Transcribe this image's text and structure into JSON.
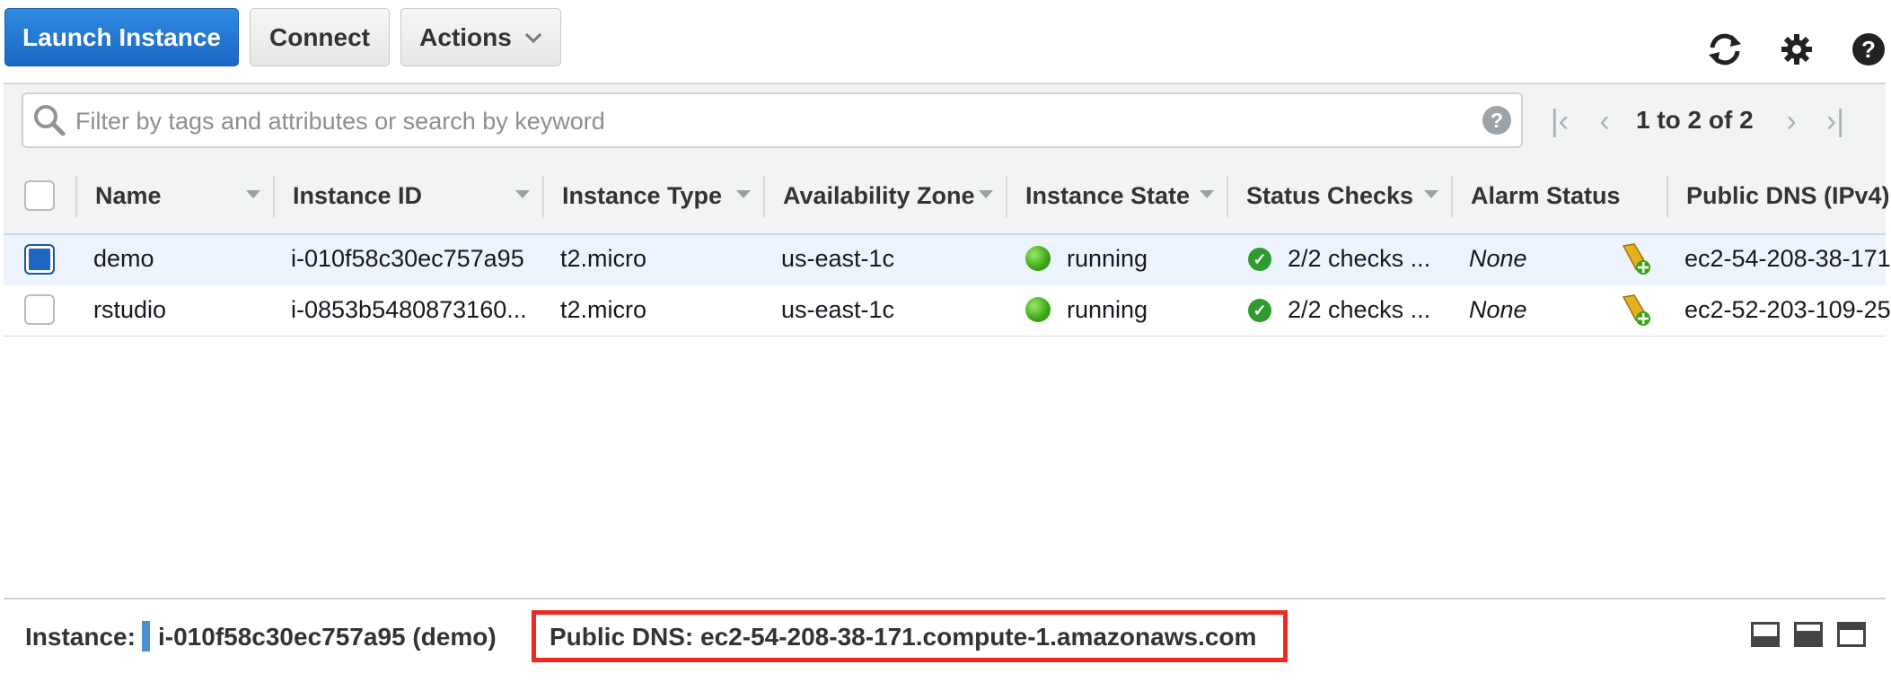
{
  "toolbar": {
    "launch_label": "Launch Instance",
    "connect_label": "Connect",
    "actions_label": "Actions"
  },
  "icons": {
    "refresh": "refresh-icon",
    "settings": "gear-icon",
    "help": "help-icon"
  },
  "search": {
    "placeholder": "Filter by tags and attributes or search by keyword"
  },
  "pagination": {
    "text": "1 to 2 of 2"
  },
  "table": {
    "columns": [
      "Name",
      "Instance ID",
      "Instance Type",
      "Availability Zone",
      "Instance State",
      "Status Checks",
      "Alarm Status",
      "Public DNS (IPv4)"
    ],
    "rows": [
      {
        "selected": true,
        "name": "demo",
        "instance_id": "i-010f58c30ec757a95",
        "instance_type": "t2.micro",
        "availability_zone": "us-east-1c",
        "instance_state": "running",
        "status_checks": "2/2 checks ...",
        "alarm_status": "None",
        "public_dns": "ec2-54-208-38-171"
      },
      {
        "selected": false,
        "name": "rstudio",
        "instance_id": "i-0853b5480873160...",
        "instance_type": "t2.micro",
        "availability_zone": "us-east-1c",
        "instance_state": "running",
        "status_checks": "2/2 checks ...",
        "alarm_status": "None",
        "public_dns": "ec2-52-203-109-25"
      }
    ]
  },
  "footer": {
    "instance_label": "Instance:",
    "instance_value": "i-010f58c30ec757a95 (demo)",
    "public_dns": "Public DNS: ec2-54-208-38-171.compute-1.amazonaws.com"
  },
  "colors": {
    "primary_button": "#1b67c4",
    "selected_row": "#eef4fd",
    "running": "#3aa514",
    "highlight_box": "#ef2a22"
  }
}
